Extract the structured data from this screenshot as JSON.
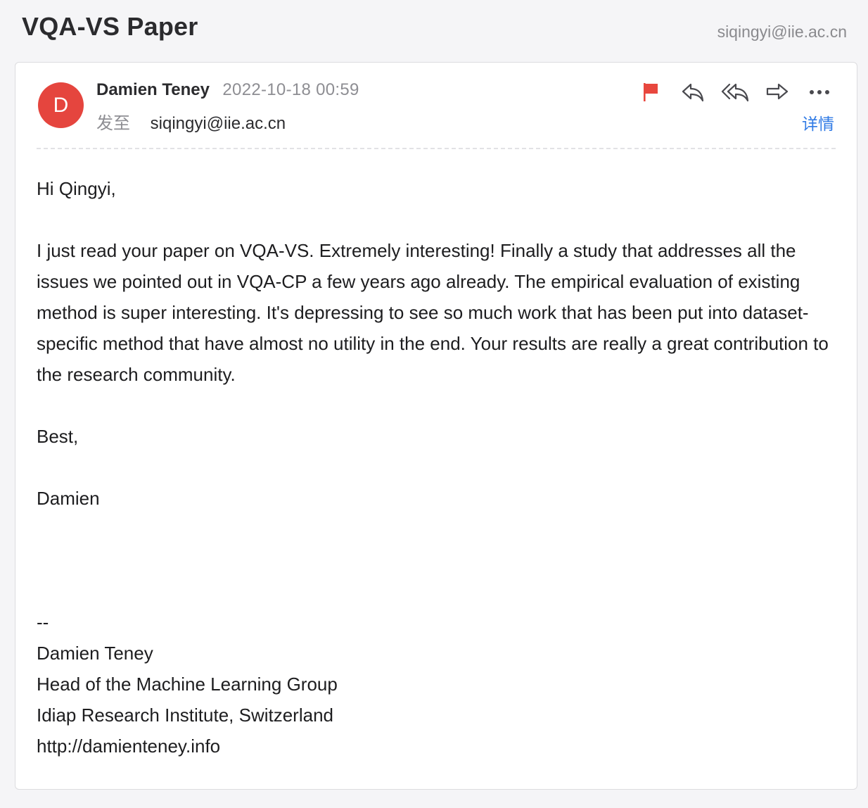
{
  "header": {
    "subject": "VQA-VS Paper",
    "account": "siqingyi@iie.ac.cn"
  },
  "message": {
    "avatar_letter": "D",
    "avatar_color": "#e5453e",
    "sender": "Damien Teney",
    "time": "2022-10-18 00:59",
    "to_label": "发至",
    "to_address": "siqingyi@iie.ac.cn",
    "details_label": "详情",
    "actions": {
      "flag_icon": "flag-icon",
      "reply_icon": "reply-icon",
      "reply_all_icon": "reply-all-icon",
      "forward_icon": "forward-icon",
      "more_icon": "more-icon"
    },
    "flag_color": "#e8473e",
    "accent_color": "#2f7ae5"
  },
  "body": {
    "greeting": "Hi Qingyi,",
    "paragraph": "I just read your paper on VQA-VS. Extremely interesting! Finally a study that addresses all the issues we pointed out in VQA-CP a few years ago already. The empirical evaluation of existing method is super interesting. It's depressing to see so much work that has been put into dataset-specific method that have almost no utility in the end. Your results are really a great contribution to the research community.",
    "closing": "Best,",
    "signoff": "Damien",
    "sig_separator": "--",
    "sig_name": "Damien Teney",
    "sig_title": "Head of the Machine Learning Group",
    "sig_org": "Idiap Research Institute, Switzerland",
    "sig_url": "http://damienteney.info"
  }
}
